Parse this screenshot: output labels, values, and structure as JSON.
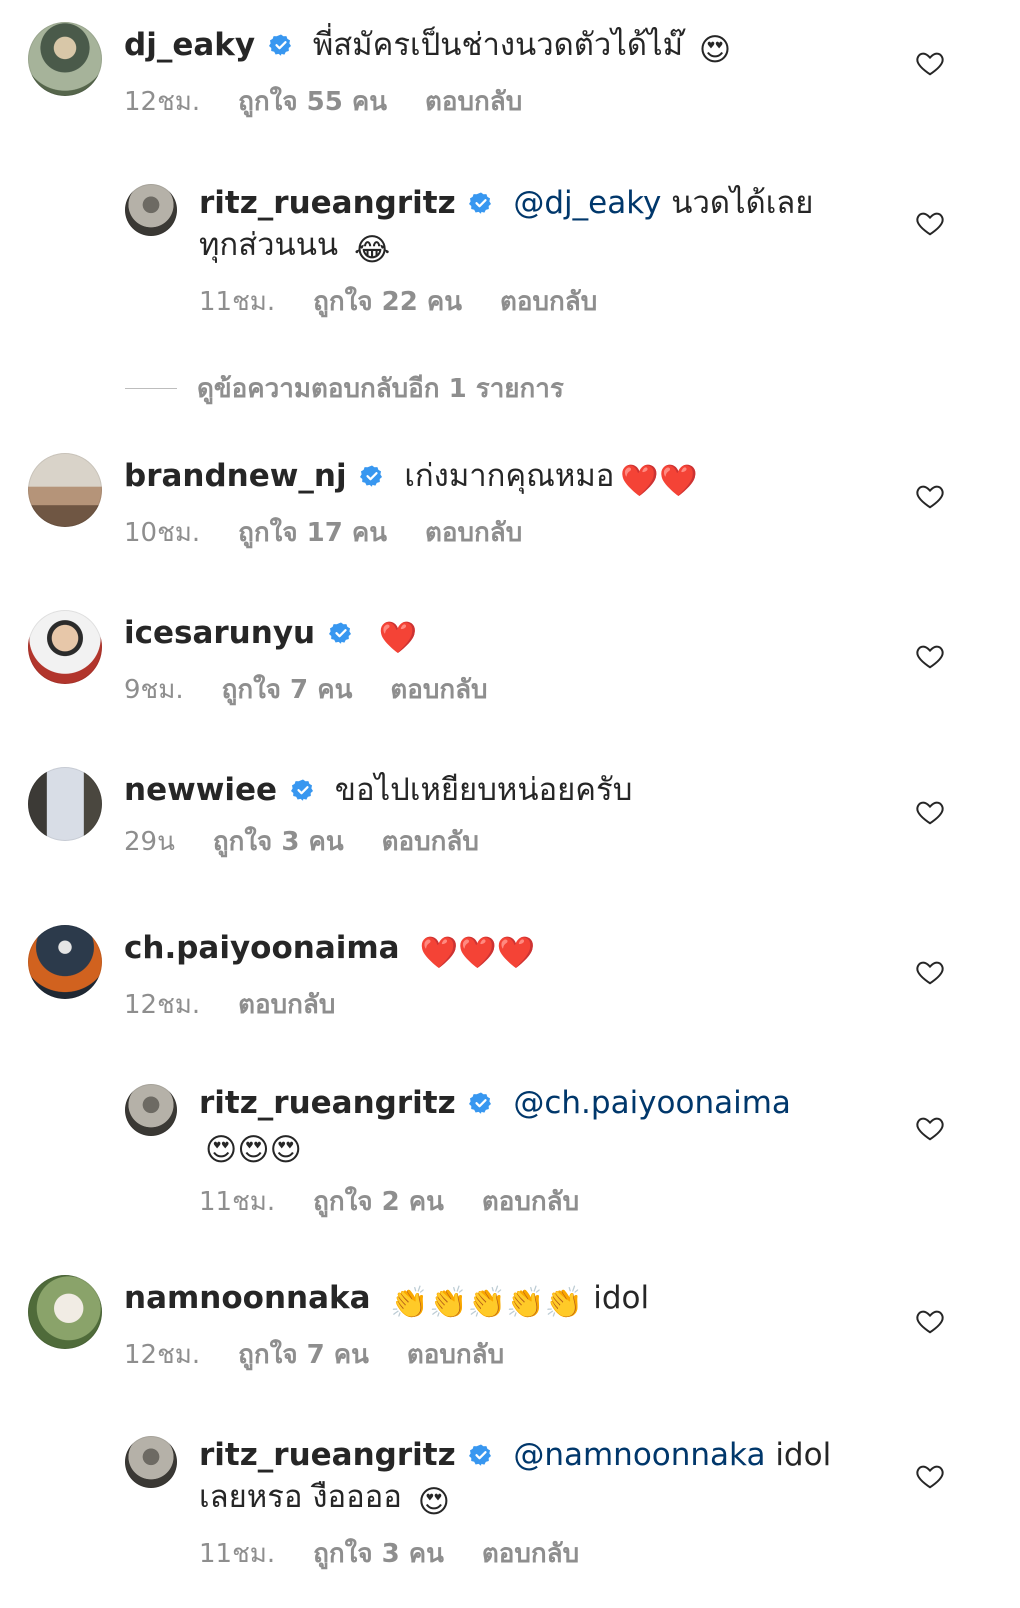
{
  "colors": {
    "text": "#262626",
    "muted": "#8e8e8e",
    "mention": "#00376b",
    "verified": "#3897f0",
    "heart": "#ed4956"
  },
  "icons": {
    "verified": "verified-badge-icon",
    "like": "heart-outline-icon"
  },
  "comments": [
    {
      "user": "dj_eaky",
      "text": "พี่สมัครเป็นช่างนวดตัวได้ไม๊",
      "emoji": "😍",
      "time": "12ชม.",
      "likes": "ถูกใจ 55 คน",
      "reply": "ตอบกลับ"
    },
    {
      "user": "ritz_rueangritz",
      "mention": "@dj_eaky",
      "text": " นวดได้เลยทุกส่วนนน",
      "emoji": "😂",
      "time": "11ชม.",
      "likes": "ถูกใจ 22 คน",
      "reply": "ตอบกลับ"
    },
    {
      "user": "brandnew_nj",
      "text": "เก่งมากคุณหมอ",
      "emoji": "❤️❤️",
      "time": "10ชม.",
      "likes": "ถูกใจ 17 คน",
      "reply": "ตอบกลับ"
    },
    {
      "user": "icesarunyu",
      "text": "",
      "emoji": "❤️",
      "time": "9ชม.",
      "likes": "ถูกใจ 7 คน",
      "reply": "ตอบกลับ"
    },
    {
      "user": "newwiee",
      "text": "ขอไปเหยียบหน่อยครับ",
      "emoji": "",
      "time": "29น",
      "likes": "ถูกใจ 3 คน",
      "reply": "ตอบกลับ"
    },
    {
      "user": "ch.paiyoonaima",
      "text": "",
      "emoji": "❤️❤️❤️",
      "time": "12ชม.",
      "likes": "",
      "reply": "ตอบกลับ"
    },
    {
      "user": "ritz_rueangritz",
      "mention": "@ch.paiyoonaima",
      "text": "",
      "emoji": "😍😍😍",
      "time": "11ชม.",
      "likes": "ถูกใจ 2 คน",
      "reply": "ตอบกลับ"
    },
    {
      "user": "namnoonnaka",
      "text": "",
      "emoji": "👏👏👏👏👏",
      "after": " idol",
      "time": "12ชม.",
      "likes": "ถูกใจ 7 คน",
      "reply": "ตอบกลับ"
    },
    {
      "user": "ritz_rueangritz",
      "mention": "@namnoonnaka",
      "text": " idol เลยหรอ งืออออ",
      "emoji": "😍",
      "time": "11ชม.",
      "likes": "ถูกใจ 3 คน",
      "reply": "ตอบกลับ"
    }
  ],
  "view_more_replies": "ดูข้อความตอบกลับอีก 1 รายการ"
}
